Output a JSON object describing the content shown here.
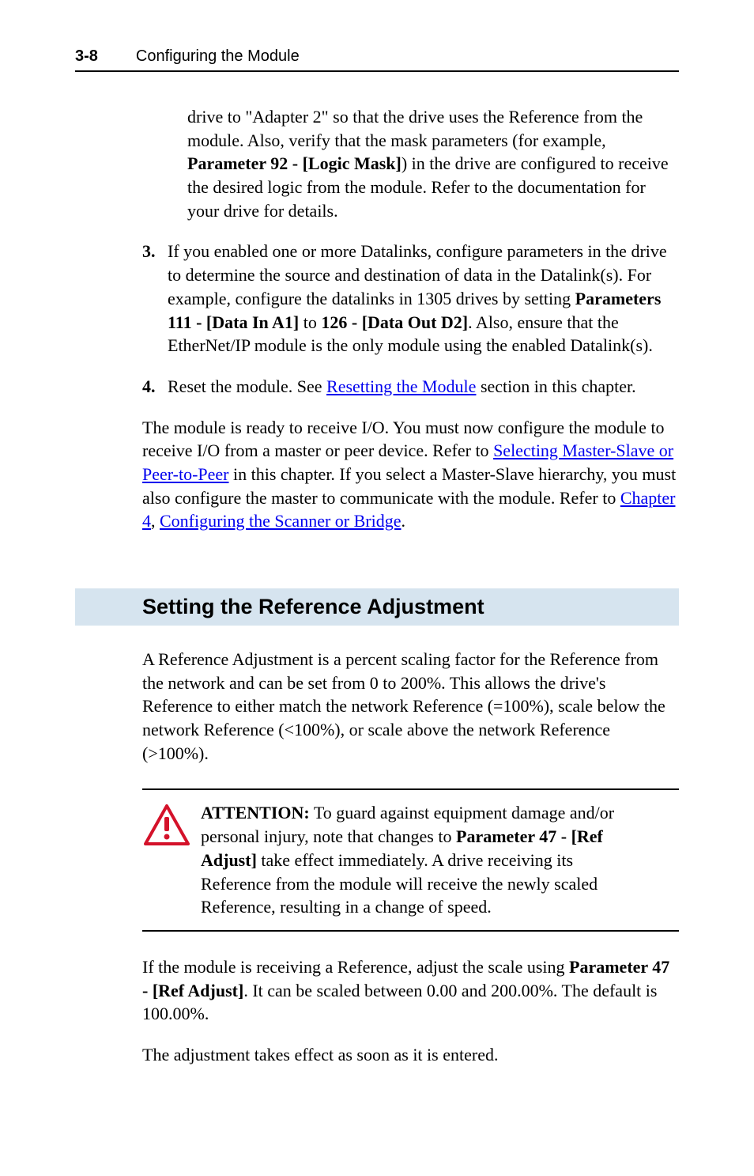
{
  "header": {
    "page_number": "3-8",
    "title": "Configuring the Module"
  },
  "intro_para": {
    "pre": "drive to \"Adapter 2\" so that the drive uses the Reference from the module. Also, verify that the mask parameters (for example, ",
    "bold": "Parameter 92 - [Logic Mask]",
    "post": ") in the drive are configured to receive the desired logic from the module. Refer to the documentation for your drive for details."
  },
  "list": {
    "item3": {
      "num": "3.",
      "pre": "If you enabled one or more Datalinks, configure parameters in the drive to determine the source and destination of data in the Datalink(s). For example, configure the datalinks in 1305 drives by setting ",
      "bold1": "Parameters 111 - [Data In A1]",
      "mid": " to ",
      "bold2": "126 - [Data Out D2]",
      "post": ". Also, ensure that the EtherNet/IP module is the only module using the enabled Datalink(s)."
    },
    "item4": {
      "num": "4.",
      "pre": "Reset the module. See ",
      "link": "Resetting the Module",
      "post": " section in this chapter."
    }
  },
  "after_list": {
    "pre": "The module is ready to receive I/O. You must now configure the module to receive I/O from a master or peer device. Refer to ",
    "link1": "Selecting Master-Slave or Peer-to-Peer",
    "mid1": " in this chapter. If you select a Master-Slave hierarchy, you must also configure the master to communicate with the module. Refer to ",
    "link2": "Chapter 4",
    "mid2": ", ",
    "link3": "Configuring the Scanner or Bridge",
    "post": "."
  },
  "section_heading": "Setting the Reference Adjustment",
  "section_para": "A Reference Adjustment is a percent scaling factor for the Reference from the network and can be set from 0 to 200%. This allows the drive's Reference to either match the network Reference (=100%), scale below the network Reference (<100%), or scale above the network Reference (>100%).",
  "attention": {
    "label": "ATTENTION:",
    "pre": "  To guard against equipment damage and/or personal injury, note that changes to ",
    "bold": "Parameter 47 - [Ref Adjust]",
    "post": " take effect immediately. A drive receiving its Reference from the module will receive the newly scaled Reference, resulting in a change of speed."
  },
  "closing1": {
    "pre": "If the module is receiving a Reference, adjust the scale using ",
    "bold": "Parameter 47 - [Ref Adjust]",
    "post": ". It can be scaled between 0.00 and 200.00%. The default is 100.00%."
  },
  "closing2": "The adjustment takes effect as soon as it is entered."
}
